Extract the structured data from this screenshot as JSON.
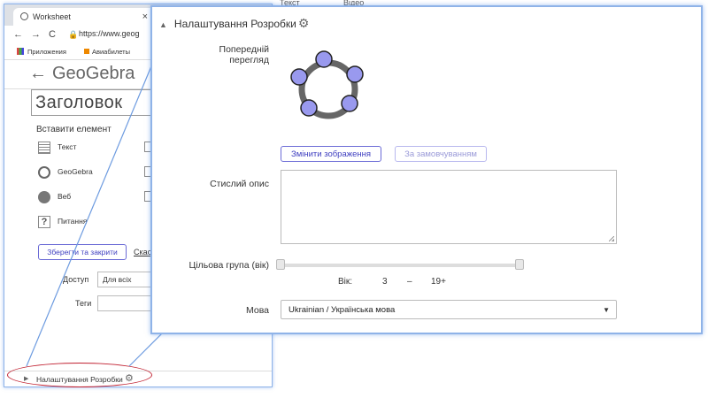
{
  "browser": {
    "tab_title": "Worksheet",
    "tab_close": "×",
    "url": "https://www.geog",
    "bookmarks": [
      "Приложения",
      "Авиабилеты"
    ]
  },
  "geogebra": {
    "logo": "GeoGebra",
    "title_field": "Заголовок",
    "insert_label": "Вставити елемент",
    "elements": [
      "Текст",
      "GeoGebra",
      "Веб",
      "Питання"
    ],
    "save_button": "Зберегти та закрити",
    "cancel_link": "Скасу",
    "access_label": "Доступ",
    "access_value": "Для всіх",
    "tags_label": "Теги",
    "dev_settings": "Налаштування Розробки"
  },
  "top_strip": [
    "Текст",
    "Відео"
  ],
  "panel": {
    "title": "Налаштування Розробки",
    "preview_label": "Попередній перегляд",
    "change_image_button": "Змінити зображення",
    "default_button": "За замовчуванням",
    "description_label": "Стислий опис",
    "description_value": "",
    "audience_label": "Цільова група (вік)",
    "age_label": "Вік:",
    "age_min": "3",
    "age_sep": "–",
    "age_max": "19+",
    "slider_min_fraction": 0,
    "slider_max_fraction": 1,
    "language_label": "Мова",
    "language_value": "Ukrainian / Українська мова"
  },
  "colors": {
    "accent": "#6b6bd6",
    "highlight": "#c02030",
    "frame": "#8fb3e8",
    "preview_node": "#9999ee"
  },
  "icons": [
    "gear-icon",
    "back-arrow-icon",
    "chevron-right-icon",
    "caret-down-icon",
    "text-icon",
    "geogebra-icon",
    "web-icon",
    "question-icon"
  ]
}
